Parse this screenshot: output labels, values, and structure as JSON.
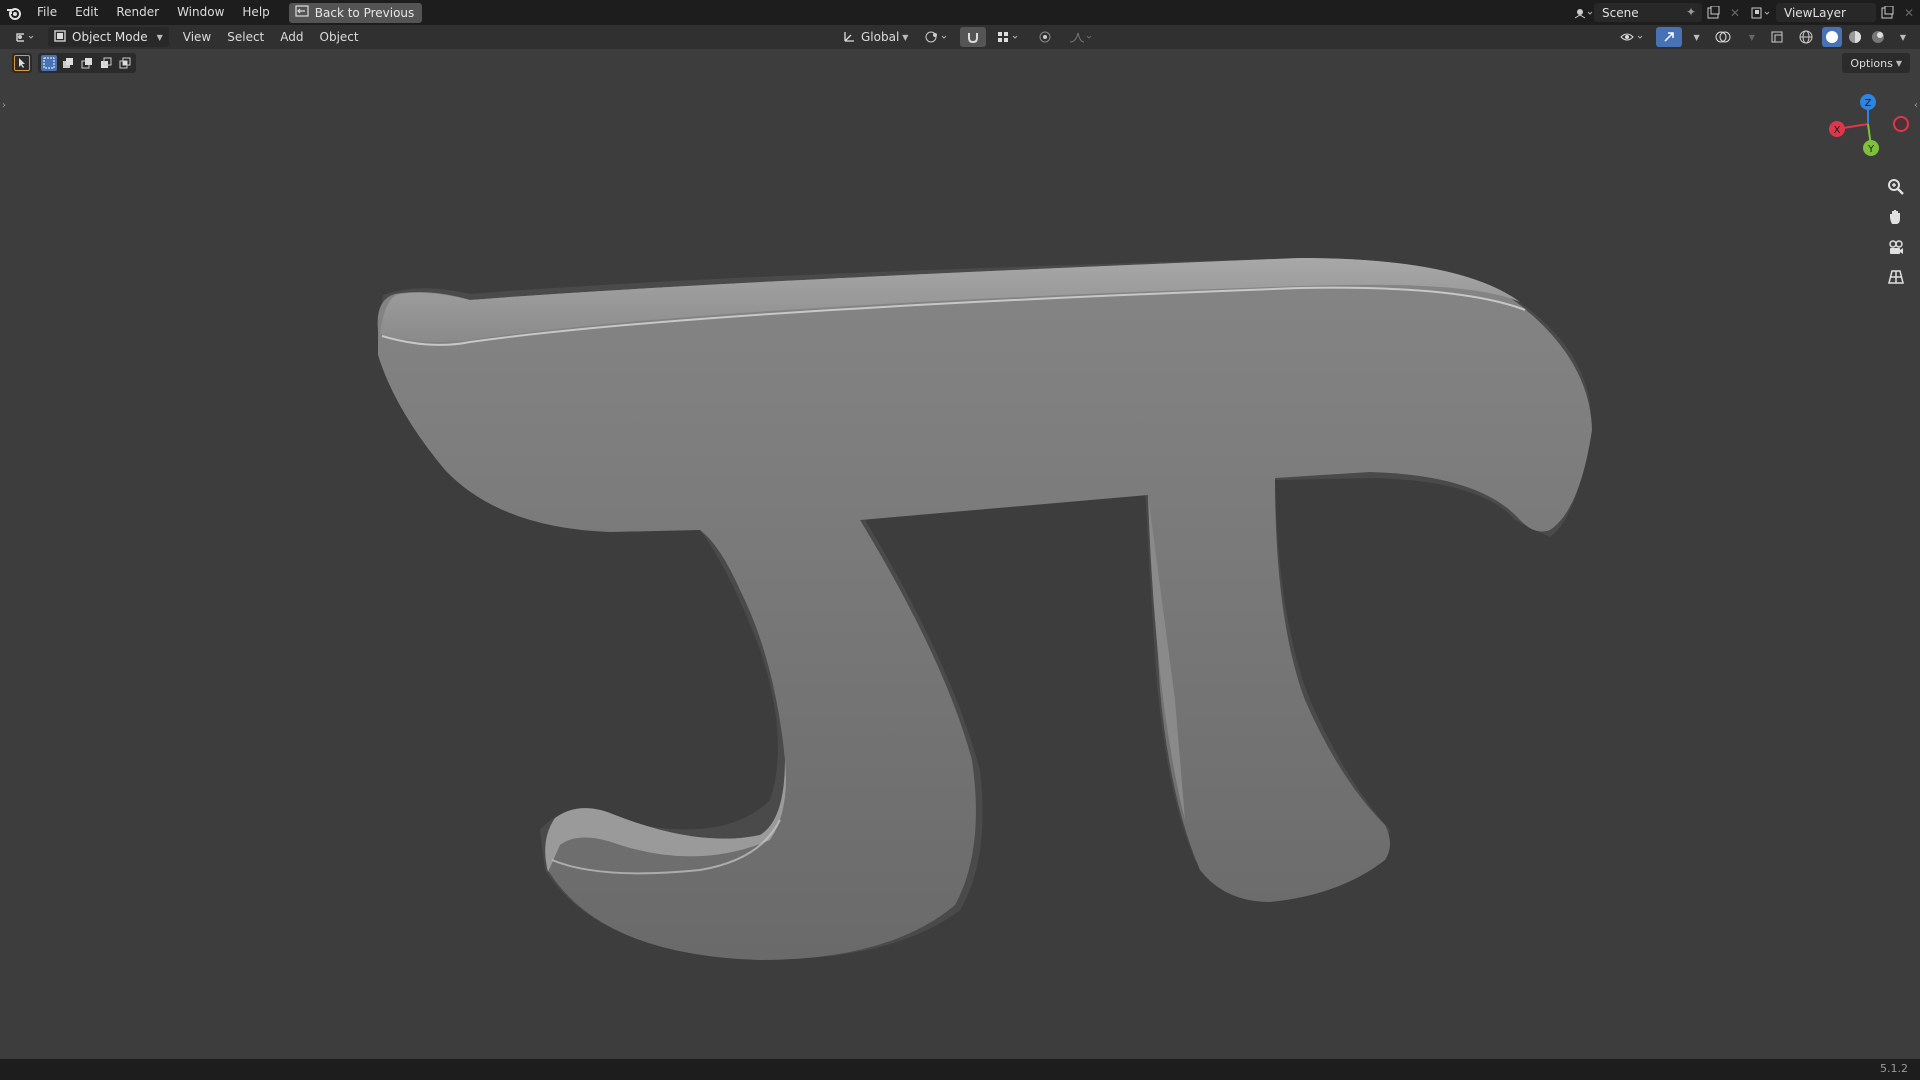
{
  "topbar": {
    "menu": [
      "File",
      "Edit",
      "Render",
      "Window",
      "Help"
    ],
    "back_button": "Back to Previous",
    "scene": "Scene",
    "view_layer": "ViewLayer"
  },
  "viewport_header": {
    "mode": "Object Mode",
    "menus": [
      "View",
      "Select",
      "Add",
      "Object"
    ],
    "transform_orientation": "Global",
    "options": "Options"
  },
  "gizmo": {
    "axes": {
      "x": "X",
      "y": "Y",
      "z": "Z"
    },
    "colors": {
      "x": "#e0364b",
      "y": "#7ec03a",
      "z": "#2f84e0"
    }
  },
  "viewport": {
    "object": "pi-symbol-mesh",
    "object_color": "#7a7a7a",
    "background": "#3d3d3d"
  },
  "statusbar": {
    "version": "5.1.2"
  }
}
